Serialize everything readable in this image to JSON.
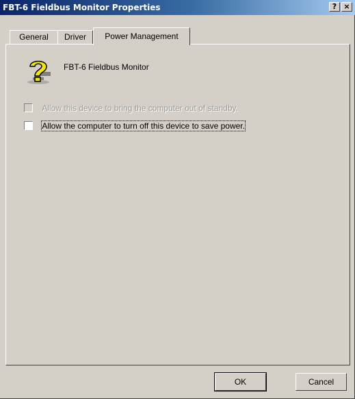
{
  "window": {
    "title": "FBT-6 Fieldbus Monitor Properties",
    "help_glyph": "?",
    "close_glyph": "×"
  },
  "tabs": [
    {
      "label": "General",
      "active": false
    },
    {
      "label": "Driver",
      "active": false
    },
    {
      "label": "Power Management",
      "active": true
    }
  ],
  "device": {
    "icon": "unknown-device-question-icon",
    "name": "FBT-6 Fieldbus Monitor"
  },
  "options": [
    {
      "label": "Allow this device to bring the computer out of standby.",
      "checked": false,
      "enabled": false
    },
    {
      "label": "Allow the computer to turn off this device to save power.",
      "checked": false,
      "enabled": true
    }
  ],
  "buttons": {
    "ok": "OK",
    "cancel": "Cancel"
  },
  "colors": {
    "title_start": "#0a246a",
    "title_end": "#a6caf0",
    "face": "#d4d0c8",
    "icon_yellow": "#f5e600"
  }
}
